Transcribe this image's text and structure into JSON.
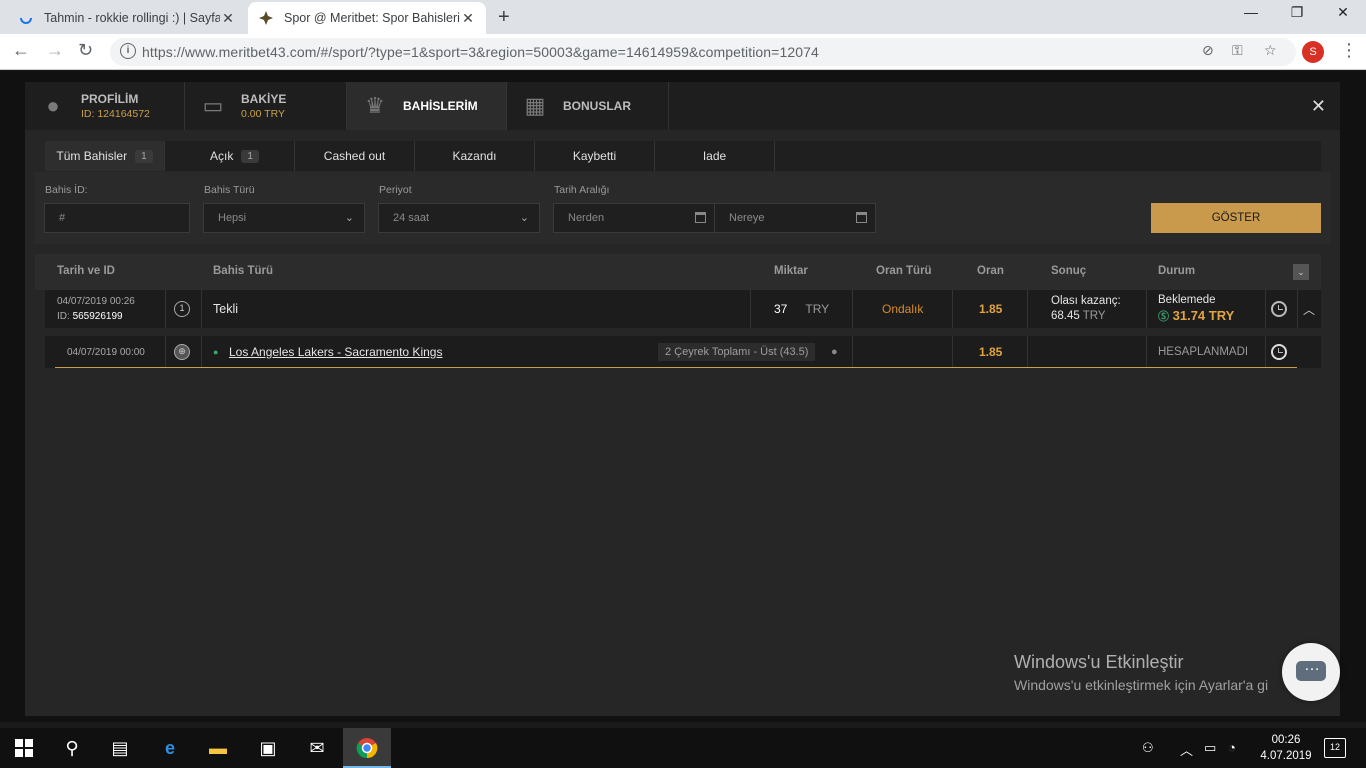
{
  "browser": {
    "tabs": [
      {
        "title": "Tahmin - rokkie rollingi :) | Sayfa",
        "active": false
      },
      {
        "title": "Spor @ Meritbet: Spor Bahisleri, C",
        "active": true
      }
    ],
    "url": "https://www.meritbet43.com/#/sport/?type=1&sport=3&region=50003&game=14614959&competition=12074",
    "profile_initial": "S"
  },
  "account_tabs": [
    {
      "label": "PROFİLİM",
      "sub": "ID: 124164572",
      "icon": "user-icon"
    },
    {
      "label": "BAKİYE",
      "sub": "0.00 TRY",
      "icon": "wallet-icon"
    },
    {
      "label": "BAHİSLERİM",
      "sub": "",
      "icon": "trophy-icon"
    },
    {
      "label": "BONUSLAR",
      "sub": "",
      "icon": "gift-icon"
    }
  ],
  "filter_tabs": [
    {
      "label": "Tüm Bahisler",
      "count": "1"
    },
    {
      "label": "Açık",
      "count": "1"
    },
    {
      "label": "Cashed out",
      "count": ""
    },
    {
      "label": "Kazandı",
      "count": ""
    },
    {
      "label": "Kaybetti",
      "count": ""
    },
    {
      "label": "Iade",
      "count": ""
    }
  ],
  "filters": {
    "bet_id_label": "Bahis İD:",
    "bet_id_placeholder": "#",
    "bet_type_label": "Bahis Türü",
    "bet_type_value": "Hepsi",
    "period_label": "Periyot",
    "period_value": "24 saat",
    "date_range_label": "Tarih Aralığı",
    "from_placeholder": "Nerden",
    "to_placeholder": "Nereye",
    "show_button": "GÖSTER"
  },
  "table": {
    "headers": {
      "date_id": "Tarih ve ID",
      "bet_type": "Bahis Türü",
      "amount": "Miktar",
      "odds_type": "Oran Türü",
      "odds": "Oran",
      "result": "Sonuç",
      "status": "Durum"
    },
    "bet": {
      "date": "04/07/2019 00:26",
      "id_label": "ID:",
      "id": "565926199",
      "count": "1",
      "type": "Tekli",
      "amount": "37",
      "currency": "TRY",
      "odds_type": "Ondalık",
      "odds": "1.85",
      "possible_win_label": "Olası kazanç:",
      "possible_win": "68.45",
      "possible_win_currency": "TRY",
      "status": "Beklemede",
      "cashout_value": "31.74 TRY"
    },
    "selection": {
      "date": "04/07/2019 00:00",
      "match": "Los Angeles Lakers - Sacramento Kings",
      "market": "2 Çeyrek Toplamı - Üst (43.5)",
      "odds": "1.85",
      "status": "HESAPLANMADI"
    }
  },
  "watermark": {
    "title": "Windows'u Etkinleştir",
    "subtitle": "Windows'u etkinleştirmek için Ayarlar'a gi"
  },
  "taskbar": {
    "time": "00:26",
    "date": "4.07.2019",
    "notifications": "12"
  }
}
